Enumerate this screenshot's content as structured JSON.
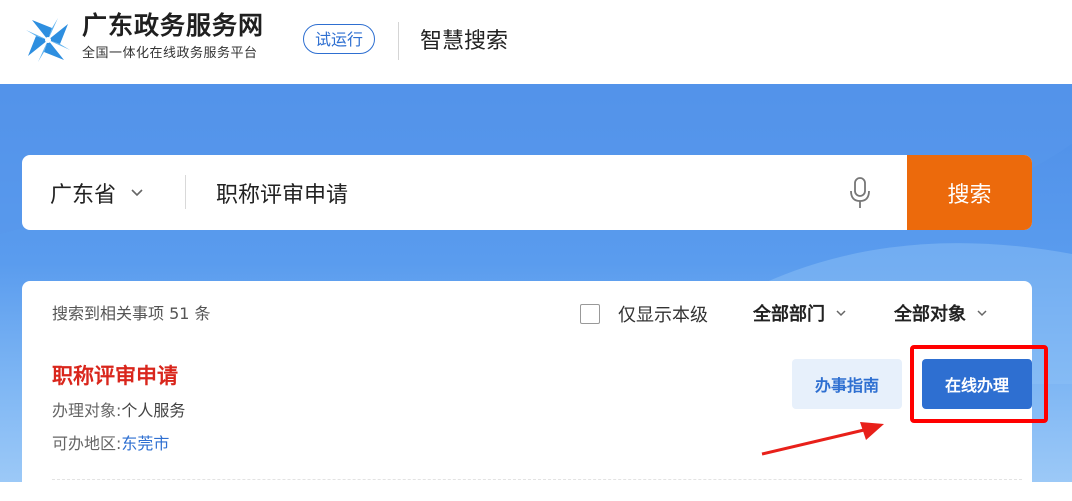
{
  "header": {
    "site_title": "广东政务服务网",
    "site_subtitle": "全国一体化在线政务服务平台",
    "trial_badge": "试运行",
    "section_title": "智慧搜索",
    "logo_icon": "pinwheel-logo-icon"
  },
  "search": {
    "region": "广东省",
    "query": "职称评审申请",
    "button_label": "搜索",
    "mic_icon": "microphone-icon",
    "region_chevron_icon": "chevron-down-icon"
  },
  "results": {
    "count_text": "搜索到相关事项 51 条",
    "filters": {
      "level_label": "仅显示本级",
      "department_label": "全部部门",
      "object_label": "全部对象"
    },
    "items": [
      {
        "title": "职称评审申请",
        "object_label": "办理对象:",
        "object_value": "个人服务",
        "area_label": "可办地区:",
        "area_value": "东莞市",
        "guide_button": "办事指南",
        "online_button": "在线办理"
      }
    ]
  },
  "colors": {
    "accent_blue": "#2e6fd1",
    "search_orange": "#ec6a0c",
    "title_red": "#d9261c",
    "highlight_red": "#ff0000"
  }
}
